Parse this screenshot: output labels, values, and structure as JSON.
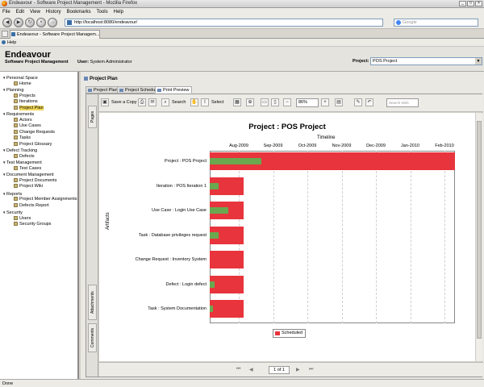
{
  "browser": {
    "window_title": "Endeavour - Software Project Management - Mozilla Firefox",
    "menu": [
      "File",
      "Edit",
      "View",
      "History",
      "Bookmarks",
      "Tools",
      "Help"
    ],
    "url": "http://localhost:8080/endeavour/",
    "search_placeholder": "Google",
    "tab_label": "Endeavour - Software Project Managem...",
    "status": "Done"
  },
  "app": {
    "help_label": "Help",
    "title": "Endeavour",
    "subtitle": "Software Project Management",
    "user_label": "User:",
    "user_value": "System Administrator",
    "project_label": "Project:",
    "project_value": "POS Project"
  },
  "sidebar": {
    "items": [
      {
        "label": "Personal Space",
        "expanded": true
      },
      {
        "label": "Home"
      },
      {
        "label": "Planning",
        "expanded": true
      },
      {
        "label": "Projects"
      },
      {
        "label": "Iterations"
      },
      {
        "label": "Project Plan",
        "selected": true
      },
      {
        "label": "Requirements",
        "expanded": true
      },
      {
        "label": "Actors"
      },
      {
        "label": "Use Cases"
      },
      {
        "label": "Change Requests"
      },
      {
        "label": "Tasks"
      },
      {
        "label": "Project Glossary"
      },
      {
        "label": "Defect Tracking",
        "expanded": true
      },
      {
        "label": "Defects"
      },
      {
        "label": "Test Management",
        "expanded": true
      },
      {
        "label": "Test Cases"
      },
      {
        "label": "Document Management",
        "expanded": true
      },
      {
        "label": "Project Documents"
      },
      {
        "label": "Project Wiki"
      },
      {
        "label": "Reports",
        "expanded": true
      },
      {
        "label": "Project Member Assignments"
      },
      {
        "label": "Defects Report"
      },
      {
        "label": "Security",
        "expanded": true
      },
      {
        "label": "Users"
      },
      {
        "label": "Security Groups"
      }
    ]
  },
  "main": {
    "section_title": "Project Plan",
    "subtabs": [
      "Project Plan",
      "Project Schedule",
      "Print Preview"
    ],
    "active_subtab": 2,
    "viewer": {
      "save_label": "Save a Copy",
      "search_label": "Search",
      "select_label": "Select",
      "zoom": "86%",
      "find_placeholder": "Search Web",
      "side_tabs": [
        "Pages",
        "Attachments",
        "Comments"
      ],
      "page_indicator": "1 of 1"
    }
  },
  "chart_data": {
    "type": "gantt",
    "title": "Project : POS Project",
    "x_title": "Timeline",
    "ylabel": "Artifacts",
    "months": [
      "Aug-2009",
      "Sep-2009",
      "Oct-2009",
      "Nov-2009",
      "Dec-2009",
      "Jan-2010",
      "Feb-2010"
    ],
    "tasks": [
      {
        "name": "Project : POS Project",
        "start": 0.0,
        "end": 7.2,
        "progress": 0.21
      },
      {
        "name": "Iteration : POS Iteration 1",
        "start": 0.0,
        "end": 1.0,
        "progress": 0.25
      },
      {
        "name": "Use Case : Login Use Case",
        "start": 0.0,
        "end": 1.0,
        "progress": 0.55
      },
      {
        "name": "Task : Database privileges request",
        "start": 0.0,
        "end": 1.0,
        "progress": 0.25
      },
      {
        "name": "Change Request : Inventory System",
        "start": 0.0,
        "end": 1.0,
        "progress": 0.0
      },
      {
        "name": "Defect : Login defect",
        "start": 0.0,
        "end": 1.0,
        "progress": 0.15
      },
      {
        "name": "Task : System Documentation",
        "start": 0.0,
        "end": 1.0,
        "progress": 0.1
      }
    ],
    "legend": [
      "Scheduled"
    ],
    "colors": {
      "scheduled": "#e8343c",
      "progress": "#6aa84f"
    }
  }
}
